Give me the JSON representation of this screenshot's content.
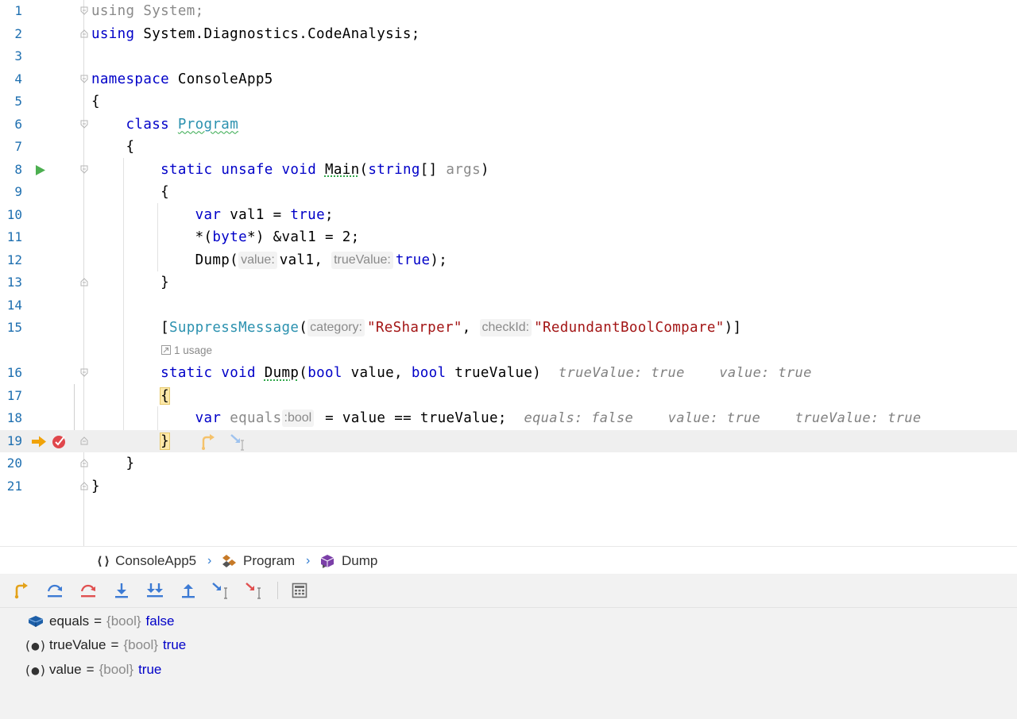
{
  "editor": {
    "lines": [
      {
        "n": "1"
      },
      {
        "n": "2"
      },
      {
        "n": "3"
      },
      {
        "n": "4"
      },
      {
        "n": "5"
      },
      {
        "n": "6"
      },
      {
        "n": "7"
      },
      {
        "n": "8"
      },
      {
        "n": "9"
      },
      {
        "n": "10"
      },
      {
        "n": "11"
      },
      {
        "n": "12"
      },
      {
        "n": "13"
      },
      {
        "n": "14"
      },
      {
        "n": "15"
      },
      {
        "n": "16"
      },
      {
        "n": "17"
      },
      {
        "n": "18"
      },
      {
        "n": "19"
      },
      {
        "n": "20"
      },
      {
        "n": "21"
      }
    ],
    "code": {
      "l1_using": "using",
      "l1_rest": " System;",
      "l2_using": "using",
      "l2_rest": " System.Diagnostics.CodeAnalysis;",
      "l4_ns": "namespace",
      "l4_name": " ConsoleApp5",
      "l5": "{",
      "l6_class": "class",
      "l6_name": "Program",
      "l7": "{",
      "l8_static": "static",
      "l8_unsafe": "unsafe",
      "l8_void": "void",
      "l8_main": "Main",
      "l8_paren": "(",
      "l8_string": "string",
      "l8_arr": "[] ",
      "l8_args": "args",
      "l8_close": ")",
      "l9": "{",
      "l10_var": "var",
      "l10_mid": " val1 = ",
      "l10_true": "true",
      "l10_end": ";",
      "l11_a": "*(",
      "l11_byte": "byte",
      "l11_b": "*) &val1 = 2;",
      "l12_a": "Dump(",
      "l12_hint1": "value:",
      "l12_b": "val1, ",
      "l12_hint2": "trueValue:",
      "l12_true": "true",
      "l12_end": ");",
      "l13": "}",
      "l15_a": "[",
      "l15_attr": "SuppressMessage",
      "l15_b": "(",
      "l15_hint1": "category:",
      "l15_str1": "\"ReSharper\"",
      "l15_c": ", ",
      "l15_hint2": "checkId:",
      "l15_str2": "\"RedundantBoolCompare\"",
      "l15_end": ")]",
      "usage": "1 usage",
      "l16_static": "static",
      "l16_void": "void",
      "l16_dump": "Dump",
      "l16_a": "(",
      "l16_bool1": "bool",
      "l16_b": " value, ",
      "l16_bool2": "bool",
      "l16_c": " trueValue)",
      "l16_inl1": "trueValue: true",
      "l16_inl2": "value: true",
      "l17": "{",
      "l18_var": "var",
      "l18_equals": "equals",
      "l18_hint": ":bool",
      "l18_rest": " = value == trueValue;",
      "l18_inl1": "equals: false",
      "l18_inl2": "value: true",
      "l18_inl3": "trueValue: true",
      "l19": "}",
      "l20": "}",
      "l21": "}"
    }
  },
  "breadcrumb": {
    "items": [
      "ConsoleApp5",
      "Program",
      "Dump"
    ],
    "separator": "›"
  },
  "toolbar": {
    "buttons": [
      "show-execution-point",
      "step-over",
      "force-step-over",
      "step-into",
      "force-step-into",
      "step-out",
      "run-to-cursor",
      "force-run-to-cursor",
      "evaluate-expression"
    ]
  },
  "variables": [
    {
      "name": "equals",
      "eq": "=",
      "type": "{bool}",
      "value": "false"
    },
    {
      "name": "trueValue",
      "eq": "=",
      "type": "{bool}",
      "value": "true"
    },
    {
      "name": "value",
      "eq": "=",
      "type": "{bool}",
      "value": "true"
    }
  ],
  "colors": {
    "keyword": "#0000c8",
    "type_name": "#2b91af",
    "string": "#a31515",
    "line_number": "#1e6fb0",
    "current_line": "#efefef",
    "execution_arrow": "#f0a30a",
    "breakpoint": "#e0474c",
    "run_gutter": "#4caf50"
  }
}
